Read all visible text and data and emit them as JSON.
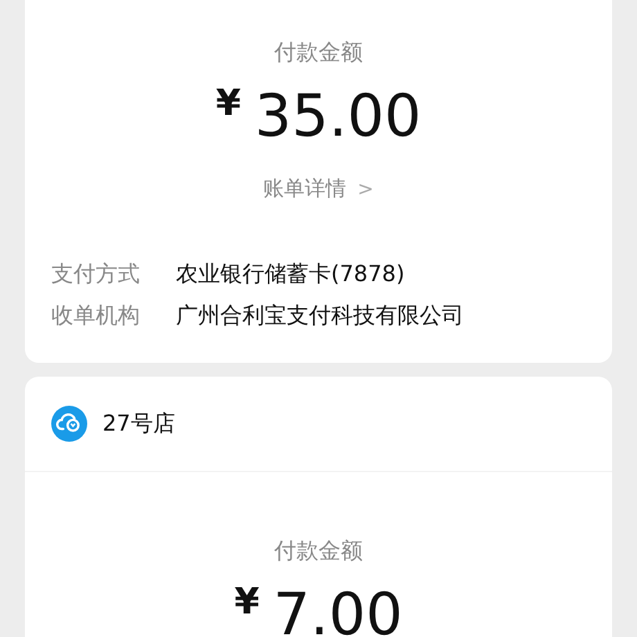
{
  "bills": [
    {
      "amount_label": "付款金额",
      "currency": "¥",
      "amount": "35.00",
      "detail_link": "账单详情",
      "detail_arrow": ">",
      "rows": [
        {
          "label": "支付方式",
          "value": "农业银行储蓄卡(7878)"
        },
        {
          "label": "收单机构",
          "value": "广州合利宝支付科技有限公司"
        }
      ]
    },
    {
      "merchant": "27号店",
      "amount_label": "付款金额",
      "currency": "¥",
      "amount": "7.00"
    }
  ]
}
